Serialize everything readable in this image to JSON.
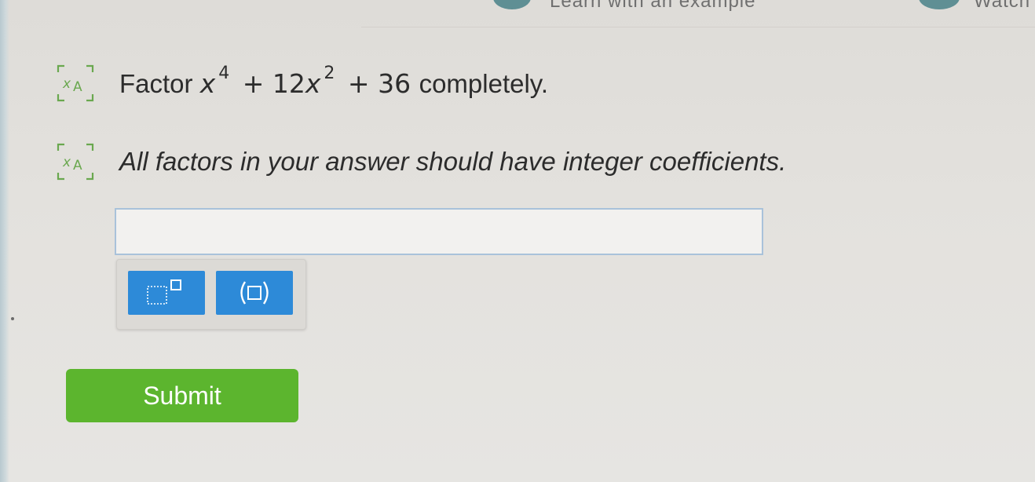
{
  "header": {
    "top_text_mid": "Learn with an example",
    "top_text_right": "Watch"
  },
  "question": {
    "prefix": "Factor",
    "term1_var": "x",
    "term1_exp": "4",
    "plus1": "+",
    "term2_coef": "12",
    "term2_var": "x",
    "term2_exp": "2",
    "plus2": "+",
    "term3": "36",
    "suffix": "completely."
  },
  "instruction": "All factors in your answer should have integer coefficients.",
  "answer": {
    "value": "",
    "placeholder": ""
  },
  "toolbar": {
    "exponent_icon": "exponent-template-icon",
    "parentheses_icon": "parentheses-template-icon",
    "button_color": "#2d8ad8"
  },
  "submit": {
    "label": "Submit",
    "color": "#5cb52e"
  },
  "icons": {
    "tts": "text-to-speech-icon",
    "tts_color": "#6aa84f"
  }
}
